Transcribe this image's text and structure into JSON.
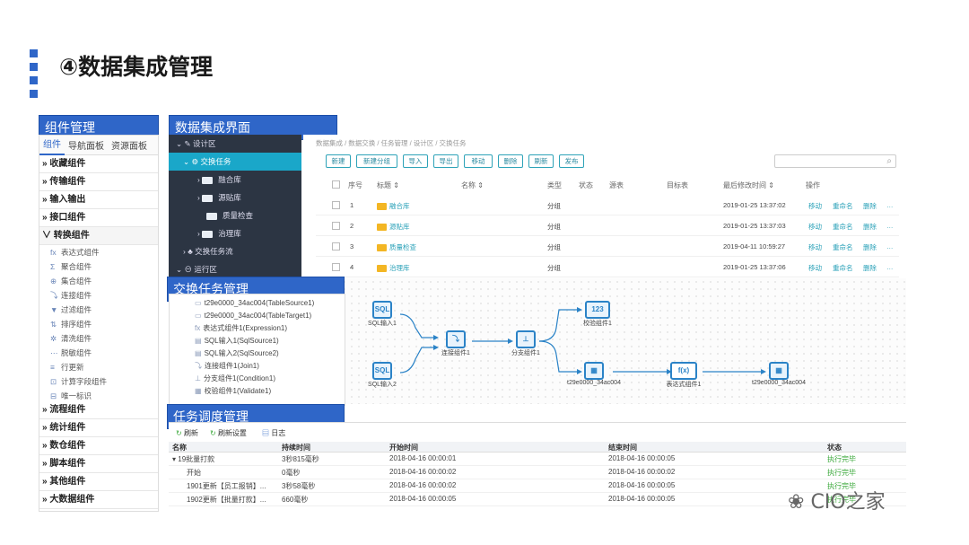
{
  "page": {
    "title": "④数据集成管理"
  },
  "labels": {
    "components": "组件管理",
    "integration": "数据集成界面",
    "exchange": "交换任务管理",
    "schedule": "任务调度管理"
  },
  "left": {
    "tabs": [
      "组件",
      "导航面板",
      "资源面板"
    ],
    "groups_top": [
      "收藏组件",
      "传输组件",
      "输入输出",
      "接口组件",
      "转换组件"
    ],
    "sub": [
      {
        "icon": "fx",
        "label": "表达式组件"
      },
      {
        "icon": "Σ",
        "label": "聚合组件"
      },
      {
        "icon": "⊕",
        "label": "集合组件"
      },
      {
        "icon": "⤵",
        "label": "连接组件"
      },
      {
        "icon": "▼",
        "label": "过滤组件"
      },
      {
        "icon": "⇅",
        "label": "排序组件"
      },
      {
        "icon": "✲",
        "label": "清洗组件"
      },
      {
        "icon": "⋯",
        "label": "脱敏组件"
      },
      {
        "icon": "≡",
        "label": "行更新"
      },
      {
        "icon": "⊡",
        "label": "计算字段组件"
      },
      {
        "icon": "⊟",
        "label": "唯一标识"
      }
    ],
    "groups_bottom": [
      "流程组件",
      "统计组件",
      "数仓组件",
      "脚本组件",
      "其他组件",
      "大数据组件"
    ]
  },
  "tree": {
    "design": "设计区",
    "exchange_task": "交换任务",
    "folders": [
      "融合库",
      "源贴库",
      "质量检查",
      "治理库"
    ],
    "flow": "交换任务流",
    "runtime": "运行区"
  },
  "main": {
    "breadcrumb": "数据集成 / 数据交换 / 任务管理 / 设计区 / 交换任务",
    "toolbar": [
      "新建",
      "新建分组",
      "导入",
      "导出",
      "移动",
      "删除",
      "刷新",
      "发布"
    ],
    "search_icon": "⌕",
    "headers": [
      "序号",
      "标题 ⇕",
      "名称 ⇕",
      "类型",
      "状态",
      "源表",
      "目标表",
      "最后修改时间 ⇕",
      "操作"
    ],
    "rows": [
      {
        "no": "1",
        "title": "融合库",
        "type": "分组",
        "time": "2019-01-25 13:37:02"
      },
      {
        "no": "2",
        "title": "源贴库",
        "type": "分组",
        "time": "2019-01-25 13:37:03"
      },
      {
        "no": "3",
        "title": "质量检查",
        "type": "分组",
        "time": "2019-04-11 10:59:27"
      },
      {
        "no": "4",
        "title": "治理库",
        "type": "分组",
        "time": "2019-01-25 13:37:06"
      }
    ],
    "ops": [
      "移动",
      "重命名",
      "删除",
      "…"
    ]
  },
  "flow": {
    "nodes": {
      "sql1": "SQL输入1",
      "sql2": "SQL输入2",
      "join": "连接组件1",
      "split": "分支组件1",
      "validate": "校验组件1",
      "src": "t29e0000_34ac004",
      "expr": "表达式组件1",
      "tgt": "t29e0000_34ac004"
    },
    "sql_icon": "SQL",
    "num_icon": "123",
    "fx_icon": "f(x)"
  },
  "exchange_list": [
    "t29e0000_34ac004(TableSource1)",
    "t29e0000_34ac004(TableTarget1)",
    "表达式组件1(Expression1)",
    "SQL输入1(SqlSource1)",
    "SQL输入2(SqlSource2)",
    "连接组件1(Join1)",
    "分支组件1(Condition1)",
    "校验组件1(Validate1)"
  ],
  "schedule": {
    "buttons": [
      "刷新",
      "刷新设置",
      "日志"
    ],
    "headers": [
      "名称",
      "持续时间",
      "开始时间",
      "结束时间",
      "状态"
    ],
    "rows": [
      {
        "name": "▾ 19批量打款",
        "dur": "3秒815毫秒",
        "start": "2018-04-16 00:00:01",
        "end": "2018-04-16 00:00:05",
        "status": "执行完毕"
      },
      {
        "name": "开始",
        "dur": "0毫秒",
        "start": "2018-04-16 00:00:02",
        "end": "2018-04-16 00:00:02",
        "status": "执行完毕"
      },
      {
        "name": "1901更新【员工报销】...",
        "dur": "3秒58毫秒",
        "start": "2018-04-16 00:00:02",
        "end": "2018-04-16 00:00:05",
        "status": "执行完毕"
      },
      {
        "name": "1902更新【批量打款】...",
        "dur": "660毫秒",
        "start": "2018-04-16 00:00:05",
        "end": "2018-04-16 00:00:05",
        "status": "执行完毕"
      }
    ]
  },
  "watermark": "CIO之家"
}
